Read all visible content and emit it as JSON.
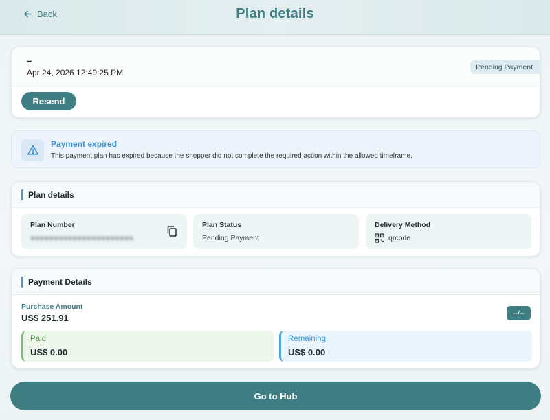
{
  "header": {
    "back_label": "Back",
    "title": "Plan details"
  },
  "summary": {
    "dash": "–",
    "datetime": "Apr 24, 2026 12:49:25 PM",
    "status_badge": "Pending Payment",
    "resend_label": "Resend"
  },
  "alert": {
    "icon": "warning-icon",
    "title": "Payment expired",
    "message": "This payment plan has expired because the shopper did not complete the required action within the allowed timeframe."
  },
  "plan_details": {
    "section_title": "Plan details",
    "plan_number_label": "Plan Number",
    "plan_number_value": "●●●●●●●●●●●●●●●●●●●●●●",
    "plan_status_label": "Plan Status",
    "plan_status_value": "Pending Payment",
    "delivery_method_label": "Delivery Method",
    "delivery_method_value": "qrcode"
  },
  "payment_details": {
    "section_title": "Payment Details",
    "purchase_amount_label": "Purchase Amount",
    "purchase_amount_value": "US$ 251.91",
    "installment_badge": "--/--",
    "paid_label": "Paid",
    "paid_value": "US$ 0.00",
    "remaining_label": "Remaining",
    "remaining_value": "US$ 0.00"
  },
  "footer": {
    "go_hub_label": "Go to Hub"
  },
  "colors": {
    "primary": "#3f7f83",
    "info_blue": "#3b93d6",
    "paid_green": "#7bbf6e",
    "remaining_blue": "#4fa7e3"
  }
}
